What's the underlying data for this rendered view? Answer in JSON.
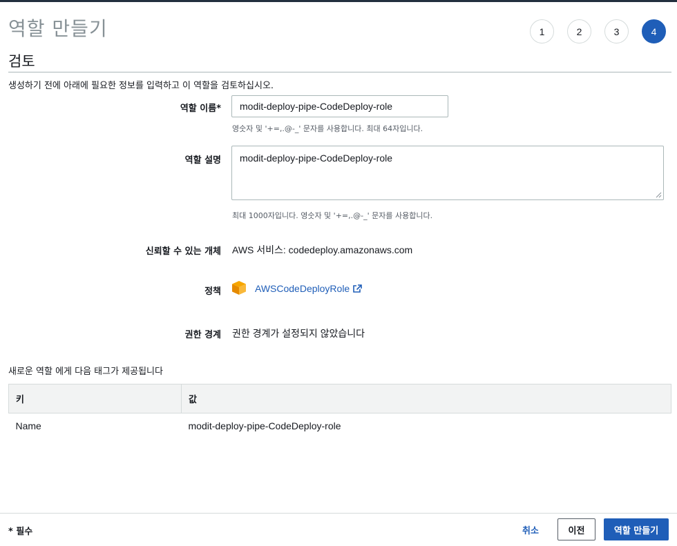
{
  "wizard": {
    "title": "역할 만들기",
    "steps": [
      "1",
      "2",
      "3",
      "4"
    ],
    "active_step": 4
  },
  "review": {
    "section_title": "검토",
    "intro": "생성하기 전에 아래에 필요한 정보를 입력하고 이 역할을 검토하십시오.",
    "role_name": {
      "label": "역할 이름*",
      "value": "modit-deploy-pipe-CodeDeploy-role",
      "hint": "영숫자 및 '+=,.@-_' 문자를 사용합니다. 최대 64자입니다."
    },
    "role_description": {
      "label": "역할 설명",
      "value": "modit-deploy-pipe-CodeDeploy-role",
      "hint": "최대 1000자입니다. 영숫자 및 '+=,.@-_' 문자를 사용합니다."
    },
    "trusted_entity": {
      "label": "신뢰할 수 있는 개체",
      "value": "AWS 서비스: codedeploy.amazonaws.com"
    },
    "policy": {
      "label": "정책",
      "icon": "policy-cube-icon",
      "link_text": "AWSCodeDeployRole",
      "link_icon": "external-link-icon"
    },
    "permissions_boundary": {
      "label": "권한 경계",
      "value": "권한 경계가 설정되지 않았습니다"
    }
  },
  "tags": {
    "caption": "새로운 역할 에게 다음 태그가 제공됩니다",
    "headers": [
      "키",
      "값"
    ],
    "rows": [
      {
        "key": "Name",
        "value": "modit-deploy-pipe-CodeDeploy-role"
      }
    ]
  },
  "footer": {
    "required_note": "* 필수",
    "cancel_label": "취소",
    "previous_label": "이전",
    "create_label": "역할 만들기"
  },
  "colors": {
    "accent": "#1f5eb8",
    "policy_icon": "#f7a600",
    "title_muted": "#879196"
  }
}
